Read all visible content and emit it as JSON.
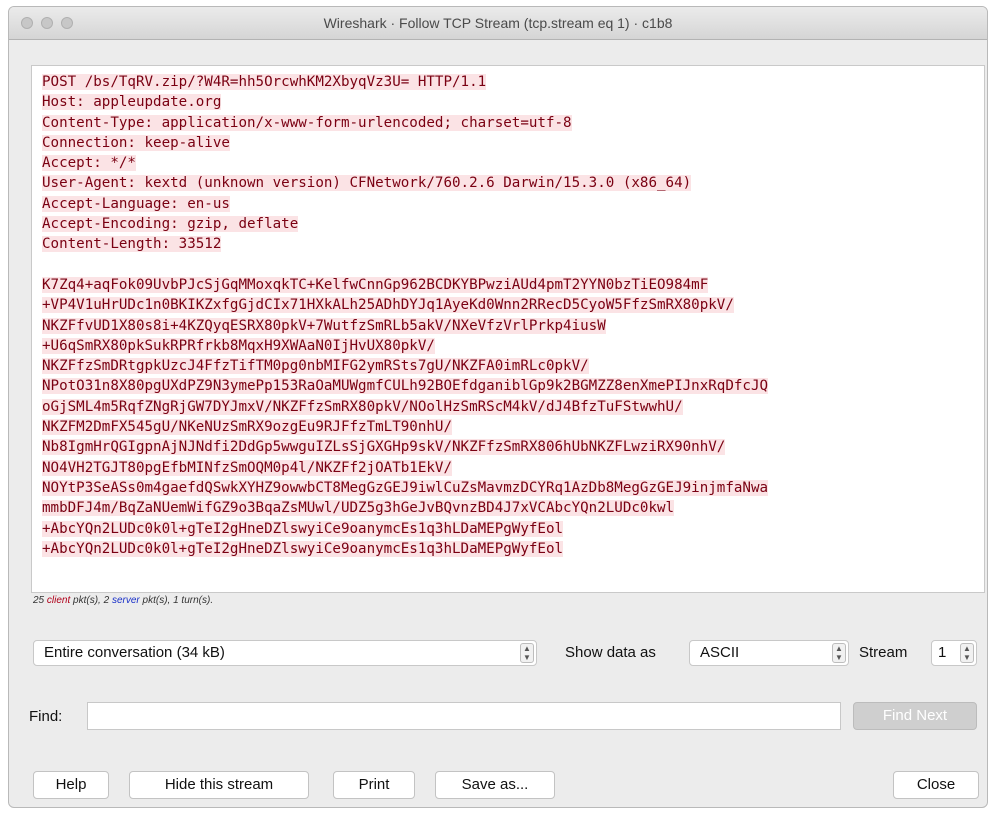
{
  "window": {
    "title": "Wireshark · Follow TCP Stream (tcp.stream eq 1) · c1b8"
  },
  "stream": {
    "lines": [
      {
        "text": "POST /bs/TqRV.zip/?W4R=hh5OrcwhKM2XbyqVz3U= HTTP/1.1"
      },
      {
        "text": "Host: appleupdate.org"
      },
      {
        "text": "Content-Type: application/x-www-form-urlencoded; charset=utf-8"
      },
      {
        "text": "Connection: keep-alive"
      },
      {
        "text": "Accept: */*"
      },
      {
        "text": "User-Agent: kextd (unknown version) CFNetwork/760.2.6 Darwin/15.3.0 (x86_64)"
      },
      {
        "text": "Accept-Language: en-us"
      },
      {
        "text": "Accept-Encoding: gzip, deflate"
      },
      {
        "text": "Content-Length: 33512"
      },
      {
        "text": ""
      },
      {
        "text": "K7Zq4+aqFok09UvbPJcSjGqMMoxqkTC+KelfwCnnGp962BCDKYBPwziAUd4pmT2YYN0bzTiEO984mF"
      },
      {
        "text": "+VP4V1uHrUDc1n0BKIKZxfgGjdCIx71HXkALh25ADhDYJq1AyeKd0Wnn2RRecD5CyoW5FfzSmRX80pkV/"
      },
      {
        "text": "NKZFfvUD1X80s8i+4KZQyqESRX80pkV+7WutfzSmRLb5akV/NXeVfzVrlPrkp4iusW"
      },
      {
        "text": "+U6qSmRX80pkSukRPRfrkb8MqxH9XWAaN0IjHvUX80pkV/"
      },
      {
        "text": "NKZFfzSmDRtgpkUzcJ4FfzTifTM0pg0nbMIFG2ymRSts7gU/NKZFA0imRLc0pkV/"
      },
      {
        "text": "NPotO31n8X80pgUXdPZ9N3ymePp153RaOaMUWgmfCULh92BOEfdganiblGp9k2BGMZZ8enXmePIJnxRqDfcJQ"
      },
      {
        "text": "oGjSML4m5RqfZNgRjGW7DYJmxV/NKZFfzSmRX80pkV/NOolHzSmRScM4kV/dJ4BfzTuFStwwhU/"
      },
      {
        "text": "NKZFM2DmFX545gU/NKeNUzSmRX9ozgEu9RJFfzTmLT90nhU/"
      },
      {
        "text": "Nb8IgmHrQGIgpnAjNJNdfi2DdGp5wwguIZLsSjGXGHp9skV/NKZFfzSmRX806hUbNKZFLwziRX90nhV/"
      },
      {
        "text": "NO4VH2TGJT80pgEfbMINfzSmOQM0p4l/NKZFf2jOATb1EkV/"
      },
      {
        "text": "NOYtP3SeASs0m4gaefdQSwkXYHZ9owwbCT8MegGzGEJ9iwlCuZsMavmzDCYRq1AzDb8MegGzGEJ9injmfaNwa"
      },
      {
        "text": "mmbDFJ4m/BqZaNUemWifGZ9o3BqaZsMUwl/UDZ5g3hGeJvBQvnzBD4J7xVCAbcYQn2LUDc0kwl"
      },
      {
        "text": "+AbcYQn2LUDc0k0l+gTeI2gHneDZlswyiCe9oanymcEs1q3hLDaMEPgWyfEol"
      },
      {
        "text": "+AbcYQn2LUDc0k0l+gTeI2gHneDZlswyiCe9oanymcEs1q3hLDaMEPgWyfEol"
      }
    ]
  },
  "summary": {
    "prefix": "25",
    "client": "client",
    "mid": "pkt(s), 2",
    "server": "server",
    "suffix": "pkt(s), 1 turn(s)."
  },
  "controls": {
    "conversation": "Entire conversation (34 kB)",
    "show_data_as_label": "Show data as",
    "show_data_as_value": "ASCII",
    "stream_label": "Stream",
    "stream_value": "1",
    "find_label": "Find:",
    "find_value": "",
    "find_next": "Find Next"
  },
  "buttons": {
    "help": "Help",
    "hide": "Hide this stream",
    "print": "Print",
    "save": "Save as...",
    "close": "Close"
  }
}
